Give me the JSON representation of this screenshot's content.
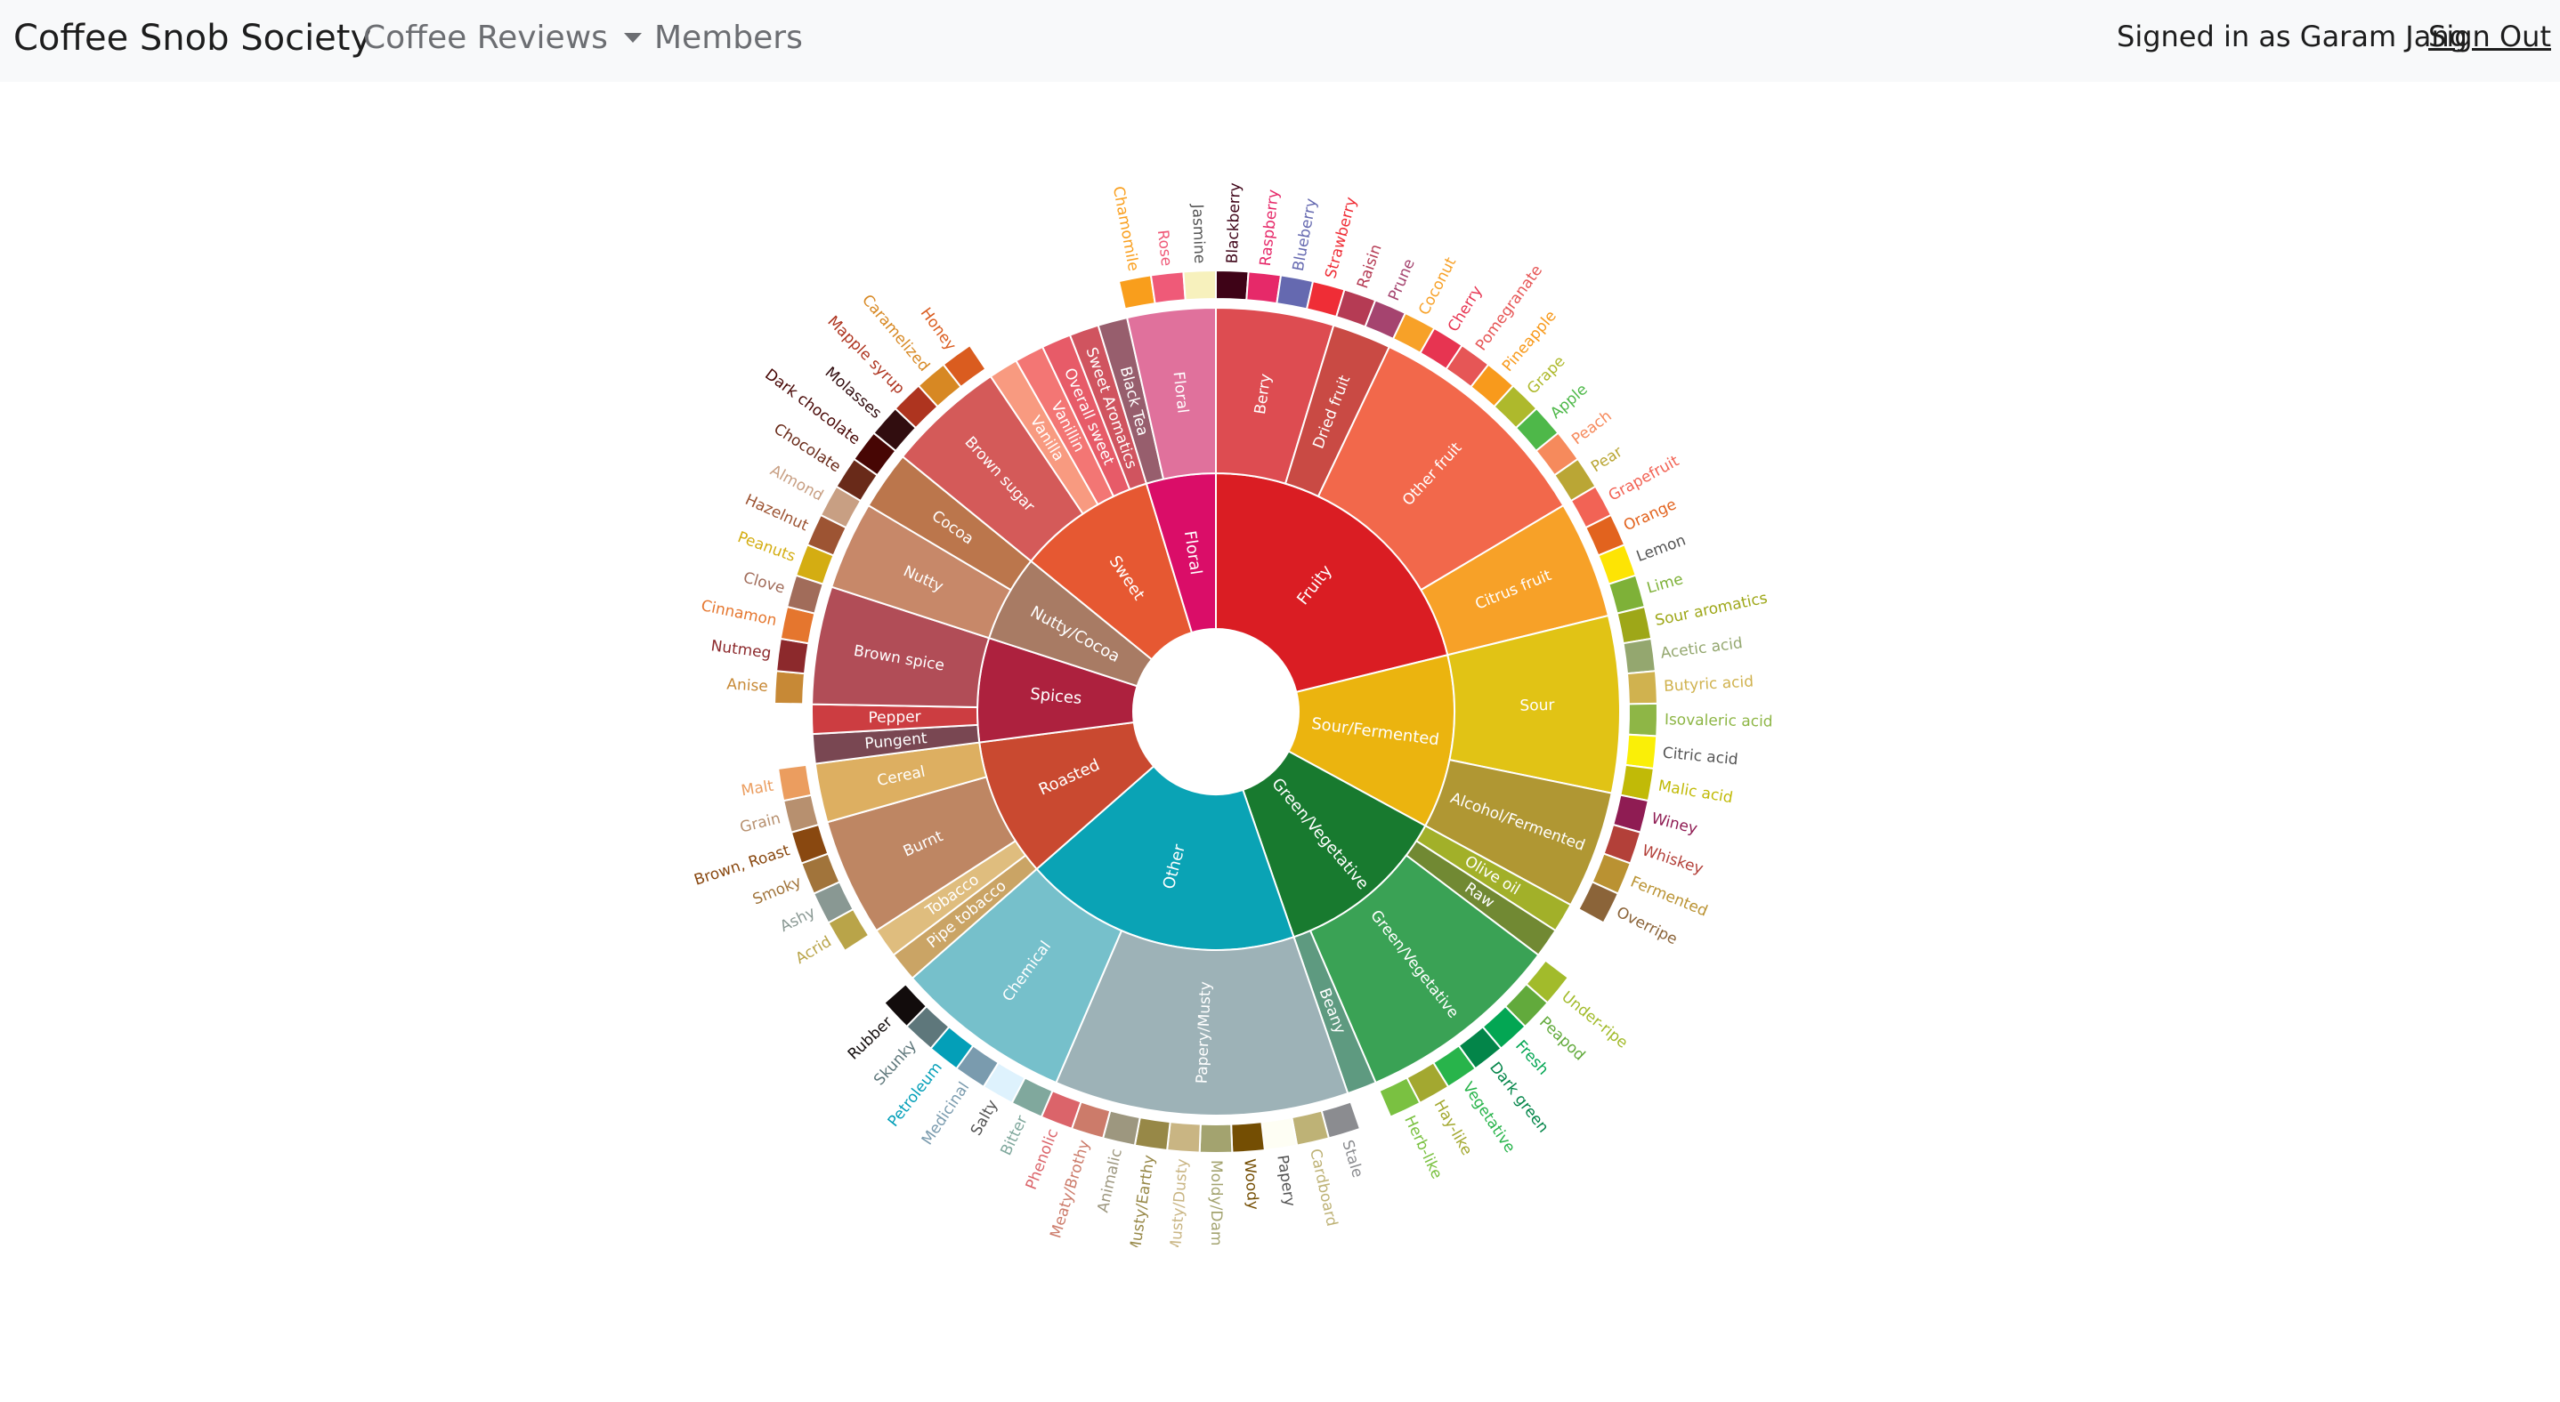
{
  "navbar": {
    "brand": "Coffee Snob Society",
    "reviews": "Coffee Reviews",
    "members": "Members",
    "signed_in": "Signed in as Garam Jang",
    "sign_out": "Sign Out"
  },
  "icons": {
    "dropdown": "caret-down-icon"
  },
  "chart_data": {
    "type": "sunburst",
    "title": "",
    "root": [
      {
        "name": "Fruity",
        "color": "#da1d23",
        "children": [
          {
            "name": "Berry",
            "color": "#dd4c51",
            "children": [
              {
                "name": "Blackberry",
                "color": "#3e0317"
              },
              {
                "name": "Raspberry",
                "color": "#e62969"
              },
              {
                "name": "Blueberry",
                "color": "#6569b0"
              },
              {
                "name": "Strawberry",
                "color": "#ef2d36"
              }
            ]
          },
          {
            "name": "Dried fruit",
            "color": "#c94a44",
            "children": [
              {
                "name": "Raisin",
                "color": "#b53b54"
              },
              {
                "name": "Prune",
                "color": "#a5446f"
              }
            ]
          },
          {
            "name": "Other fruit",
            "color": "#f2684b",
            "children": [
              {
                "name": "Coconut",
                "color": "#f7a128"
              },
              {
                "name": "Cherry",
                "color": "#e73451"
              },
              {
                "name": "Pomegranate",
                "color": "#e65656"
              },
              {
                "name": "Pineapple",
                "color": "#f89a1c"
              },
              {
                "name": "Grape",
                "color": "#aeb92c"
              },
              {
                "name": "Apple",
                "color": "#4eb849"
              },
              {
                "name": "Peach",
                "color": "#f68a5c"
              },
              {
                "name": "Pear",
                "color": "#baa635"
              }
            ]
          },
          {
            "name": "Citrus fruit",
            "color": "#f7a128",
            "children": [
              {
                "name": "Grapefruit",
                "color": "#f26355"
              },
              {
                "name": "Orange",
                "color": "#e2631e"
              },
              {
                "name": "Lemon",
                "color": "#fde404"
              },
              {
                "name": "Lime",
                "color": "#7eb138"
              }
            ]
          }
        ]
      },
      {
        "name": "Sour/Fermented",
        "color": "#ebb40f",
        "children": [
          {
            "name": "Sour",
            "color": "#e1c315",
            "children": [
              {
                "name": "Sour aromatics",
                "color": "#9ea718"
              },
              {
                "name": "Acetic acid",
                "color": "#94a76f"
              },
              {
                "name": "Butyric acid",
                "color": "#d0b24f"
              },
              {
                "name": "Isovaleric acid",
                "color": "#8eb646"
              },
              {
                "name": "Citric acid",
                "color": "#faef07"
              },
              {
                "name": "Malic acid",
                "color": "#c1ba07"
              }
            ]
          },
          {
            "name": "Alcohol/Fermented",
            "color": "#b09733",
            "children": [
              {
                "name": "Winey",
                "color": "#8f1c53"
              },
              {
                "name": "Whiskey",
                "color": "#b34039"
              },
              {
                "name": "Fermented",
                "color": "#ba9232"
              },
              {
                "name": "Overripe",
                "color": "#8b6439"
              }
            ]
          }
        ]
      },
      {
        "name": "Green/Vegetative",
        "color": "#187a2f",
        "children": [
          {
            "name": "Olive oil",
            "color": "#a2b029"
          },
          {
            "name": "Raw",
            "color": "#718933"
          },
          {
            "name": "Green/Vegetative",
            "color": "#3aa255",
            "children": [
              {
                "name": "Under-ripe",
                "color": "#a2bb2b"
              },
              {
                "name": "Peapod",
                "color": "#62aa3c"
              },
              {
                "name": "Fresh",
                "color": "#03a653"
              },
              {
                "name": "Dark green",
                "color": "#038549"
              },
              {
                "name": "Vegetative",
                "color": "#28b44b"
              },
              {
                "name": "Hay-like",
                "color": "#a3a830"
              },
              {
                "name": "Herb-like",
                "color": "#7ac141"
              }
            ]
          },
          {
            "name": "Beany",
            "color": "#5e9a80"
          }
        ]
      },
      {
        "name": "Other",
        "color": "#0aa3b5",
        "children": [
          {
            "name": "Papery/Musty",
            "color": "#9db2b7",
            "children": [
              {
                "name": "Stale",
                "color": "#8b8c90"
              },
              {
                "name": "Cardboard",
                "color": "#beb276"
              },
              {
                "name": "Papery",
                "color": "#fefef4"
              },
              {
                "name": "Woody",
                "color": "#744e03"
              },
              {
                "name": "Moldy/Damp",
                "color": "#a3a36f"
              },
              {
                "name": "Musty/Dusty",
                "color": "#c9b583"
              },
              {
                "name": "Musty/Earthy",
                "color": "#978847"
              },
              {
                "name": "Animalic",
                "color": "#9d977f"
              },
              {
                "name": "Meaty/Brothy",
                "color": "#cc7b6a"
              },
              {
                "name": "Phenolic",
                "color": "#db646a"
              }
            ]
          },
          {
            "name": "Chemical",
            "color": "#76c0cb",
            "children": [
              {
                "name": "Bitter",
                "color": "#80a89d"
              },
              {
                "name": "Salty",
                "color": "#def2fd"
              },
              {
                "name": "Medicinal",
                "color": "#7a9bae"
              },
              {
                "name": "Petroleum",
                "color": "#039fb8"
              },
              {
                "name": "Skunky",
                "color": "#5e777b"
              },
              {
                "name": "Rubber",
                "color": "#120c0c"
              }
            ]
          }
        ]
      },
      {
        "name": "Roasted",
        "color": "#c94930",
        "children": [
          {
            "name": "Pipe tobacco",
            "color": "#caa465"
          },
          {
            "name": "Tobacco",
            "color": "#dfbd7e"
          },
          {
            "name": "Burnt",
            "color": "#be8663",
            "children": [
              {
                "name": "Acrid",
                "color": "#b9a449"
              },
              {
                "name": "Ashy",
                "color": "#899893"
              },
              {
                "name": "Smoky",
                "color": "#a1743b"
              },
              {
                "name": "Brown, Roast",
                "color": "#894810"
              }
            ]
          },
          {
            "name": "Cereal",
            "color": "#ddaf61",
            "children": [
              {
                "name": "Grain",
                "color": "#b7906f"
              },
              {
                "name": "Malt",
                "color": "#eb9d5f"
              }
            ]
          }
        ]
      },
      {
        "name": "Spices",
        "color": "#ad213e",
        "children": [
          {
            "name": "Pungent",
            "color": "#794752"
          },
          {
            "name": "Pepper",
            "color": "#cc3d41"
          },
          {
            "name": "Brown spice",
            "color": "#b14d57",
            "children": [
              {
                "name": "Anise",
                "color": "#c78936"
              },
              {
                "name": "Nutmeg",
                "color": "#8c292c"
              },
              {
                "name": "Cinnamon",
                "color": "#e5762e"
              },
              {
                "name": "Clove",
                "color": "#a16c5a"
              }
            ]
          }
        ]
      },
      {
        "name": "Nutty/Cocoa",
        "color": "#a87b64",
        "children": [
          {
            "name": "Nutty",
            "color": "#c78869",
            "children": [
              {
                "name": "Peanuts",
                "color": "#d4ad12"
              },
              {
                "name": "Hazelnut",
                "color": "#9d5433"
              },
              {
                "name": "Almond",
                "color": "#c89f83"
              }
            ]
          },
          {
            "name": "Cocoa",
            "color": "#bb764c",
            "children": [
              {
                "name": "Chocolate",
                "color": "#692a19"
              },
              {
                "name": "Dark chocolate",
                "color": "#470604"
              }
            ]
          }
        ]
      },
      {
        "name": "Sweet",
        "color": "#e65832",
        "children": [
          {
            "name": "Brown sugar",
            "color": "#d45a59",
            "children": [
              {
                "name": "Molasses",
                "color": "#310d0f"
              },
              {
                "name": "Mapple syrup",
                "color": "#ae341f"
              },
              {
                "name": "Caramelized",
                "color": "#d78823"
              },
              {
                "name": "Honey",
                "color": "#da5c1f"
              }
            ]
          },
          {
            "name": "Vanilla",
            "color": "#f89a80"
          },
          {
            "name": "Vanillin",
            "color": "#f37674"
          },
          {
            "name": "Overall sweet",
            "color": "#e75b68"
          },
          {
            "name": "Sweet Aromatics",
            "color": "#d0545f"
          }
        ]
      },
      {
        "name": "Floral",
        "color": "#da0d68",
        "children": [
          {
            "name": "Black Tea",
            "color": "#975e6d"
          },
          {
            "name": "Floral",
            "color": "#e0719c",
            "children": [
              {
                "name": "Chamomile",
                "color": "#f99e1c"
              },
              {
                "name": "Rose",
                "color": "#ef5a78"
              },
              {
                "name": "Jasmine",
                "color": "#f7f1bd"
              }
            ]
          }
        ]
      }
    ]
  }
}
